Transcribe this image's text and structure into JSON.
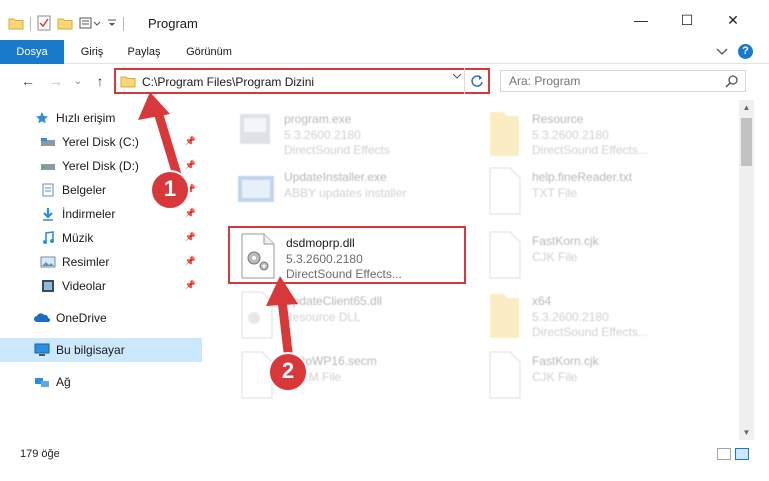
{
  "window": {
    "title": "Program",
    "minimize": "—",
    "maximize": "☐",
    "close": "✕"
  },
  "ribbon": {
    "tabs": [
      "Dosya",
      "Giriş",
      "Paylaş",
      "Görünüm"
    ],
    "help": "?"
  },
  "nav": {
    "back": "←",
    "forward": "→",
    "recent": "⌄",
    "up": "↑",
    "address": "C:\\Program Files\\Program Dizini",
    "search_placeholder": "Ara: Program"
  },
  "sidebar": {
    "items": [
      {
        "label": "Hızlı erişim",
        "icon": "star-icon",
        "pinned": false
      },
      {
        "label": "Yerel Disk (C:)",
        "icon": "drive-c-icon",
        "pinned": true
      },
      {
        "label": "Yerel Disk (D:)",
        "icon": "drive-d-icon",
        "pinned": true
      },
      {
        "label": "Belgeler",
        "icon": "documents-icon",
        "pinned": true
      },
      {
        "label": "İndirmeler",
        "icon": "downloads-icon",
        "pinned": true
      },
      {
        "label": "Müzik",
        "icon": "music-icon",
        "pinned": true
      },
      {
        "label": "Resimler",
        "icon": "pictures-icon",
        "pinned": true
      },
      {
        "label": "Videolar",
        "icon": "videos-icon",
        "pinned": true
      },
      {
        "label": "OneDrive",
        "icon": "onedrive-icon",
        "pinned": false
      },
      {
        "label": "Bu bilgisayar",
        "icon": "this-pc-icon",
        "pinned": false,
        "selected": true
      },
      {
        "label": "Ağ",
        "icon": "network-icon",
        "pinned": false
      }
    ]
  },
  "files": [
    {
      "name": "program.exe",
      "meta1": "5.3.2600.2180",
      "meta2": "DirectSound Effects",
      "icon": "exe-icon"
    },
    {
      "name": "Resource",
      "meta1": "5.3.2600.2180",
      "meta2": "DirectSound Effects...",
      "icon": "folder-icon"
    },
    {
      "name": "UpdateInstaller.exe",
      "meta1": "ABBY updates installer",
      "meta2": "",
      "icon": "installer-icon"
    },
    {
      "name": "help.fineReader.txt",
      "meta1": "TXT File",
      "meta2": "",
      "icon": "txt-icon"
    },
    {
      "name": "dsdmoprp.dll",
      "meta1": "5.3.2600.2180",
      "meta2": "DirectSound Effects...",
      "icon": "dll-gear-icon"
    },
    {
      "name": "FastKorn.cjk",
      "meta1": "CJK File",
      "meta2": "",
      "icon": "file-icon"
    },
    {
      "name": "UpdateClient65.dll",
      "meta1": "Resource DLL",
      "meta2": "",
      "icon": "dll-gear-icon"
    },
    {
      "name": "x64",
      "meta1": "5.3.2600.2180",
      "meta2": "DirectSound Effects...",
      "icon": "folder-icon"
    },
    {
      "name": "SoftoWP16.secm",
      "meta1": "SECM File",
      "meta2": "",
      "icon": "file-icon"
    },
    {
      "name": "FastKorn.cjk",
      "meta1": "CJK File",
      "meta2": "",
      "icon": "file-icon"
    }
  ],
  "annotations": {
    "step1": "1",
    "step2": "2"
  },
  "status": {
    "count": "179 öğe"
  }
}
